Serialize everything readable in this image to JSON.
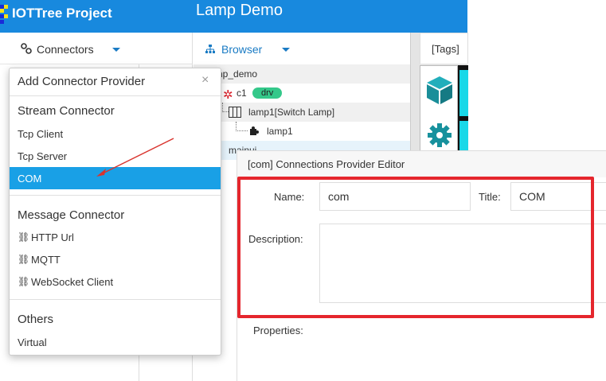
{
  "header": {
    "app_title": "IOTTree Project",
    "project_title": "Lamp Demo",
    "bg_color": "#1889de"
  },
  "connectors_toolbar": {
    "label": "Connectors",
    "icon": "link-icon"
  },
  "browser_toolbar": {
    "label": "Browser",
    "icon": "sitemap-icon"
  },
  "tree": {
    "root_label": "np_demo",
    "channel_label": "c1",
    "channel_badge": "drv",
    "device_label": "lamp1[Switch Lamp]",
    "tag_label": "lamp1",
    "selected_label": "mainui"
  },
  "right_panel": {
    "tab_label": "[Tags]",
    "icons": [
      "cube-icon",
      "gear-icon"
    ],
    "accent": "#19d8e8"
  },
  "dropdown": {
    "title": "Add Connector Provider",
    "close": "×",
    "sections": [
      {
        "title": "Stream Connector",
        "items": [
          "Tcp Client",
          "Tcp Server",
          "COM"
        ]
      },
      {
        "title": "Message Connector",
        "items": [
          "HTTP Url",
          "MQTT",
          "WebSocket Client"
        ]
      },
      {
        "title": "Others",
        "items": [
          "Virtual"
        ]
      }
    ],
    "selected_item": "COM",
    "selected_color": "#19a0e6"
  },
  "editor": {
    "title": "[com] Connections Provider Editor",
    "name_label": "Name:",
    "name_value": "com",
    "title_label": "Title:",
    "title_value": "COM",
    "description_label": "Description:",
    "description_value": "",
    "properties_label": "Properties:",
    "highlight_color": "#e5262d"
  },
  "annotation": {
    "arrow_color": "#d9342e"
  }
}
